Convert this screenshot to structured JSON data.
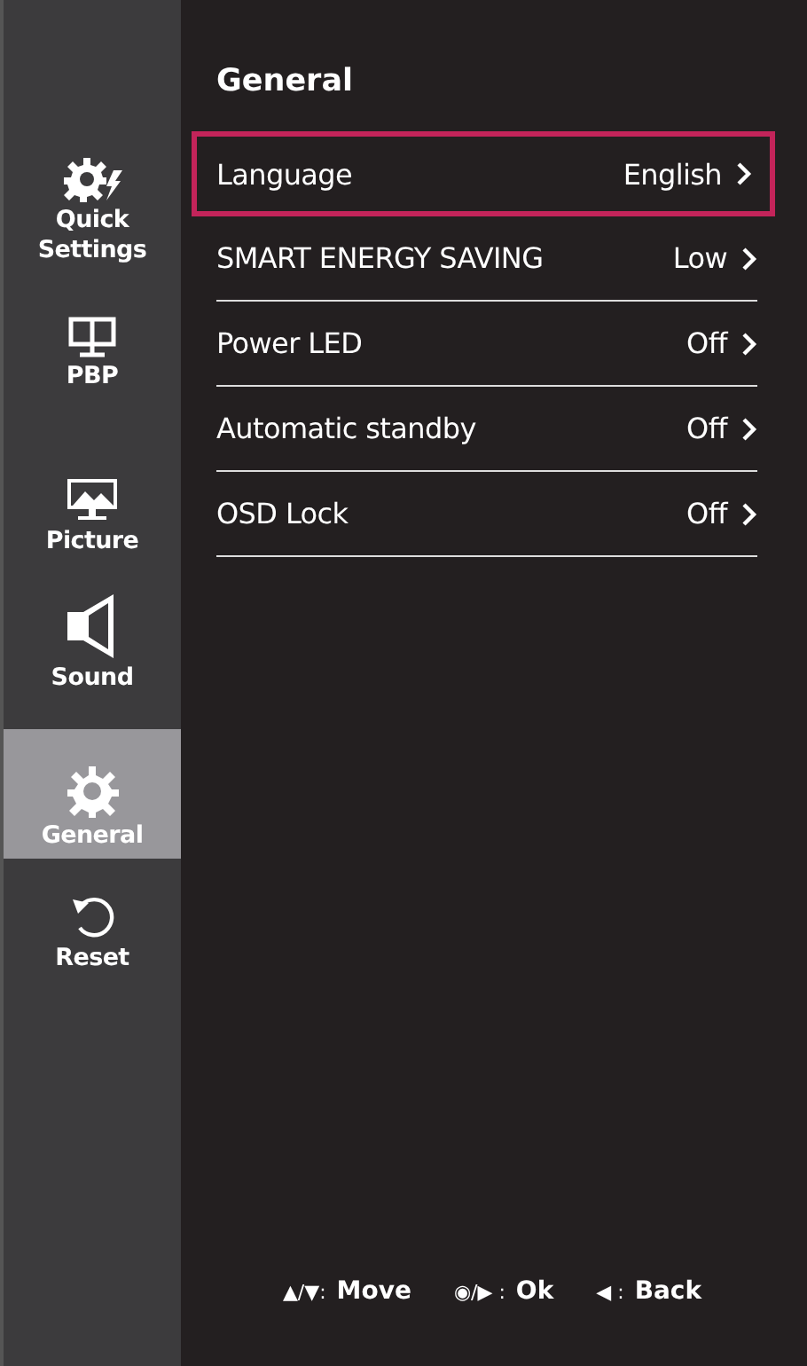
{
  "sidebar": {
    "items": [
      {
        "label": "Quick Settings",
        "selected": false
      },
      {
        "label": "PBP",
        "selected": false
      },
      {
        "label": "Picture",
        "selected": false
      },
      {
        "label": "Sound",
        "selected": false
      },
      {
        "label": "General",
        "selected": true
      },
      {
        "label": "Reset",
        "selected": false
      }
    ]
  },
  "panel": {
    "title": "General",
    "items": [
      {
        "label": "Language",
        "value": "English",
        "selected": true
      },
      {
        "label": "SMART ENERGY SAVING",
        "value": "Low",
        "selected": false
      },
      {
        "label": "Power LED",
        "value": "Off",
        "selected": false
      },
      {
        "label": "Automatic standby",
        "value": "Off",
        "selected": false
      },
      {
        "label": "OSD Lock",
        "value": "Off",
        "selected": false
      }
    ]
  },
  "footer": {
    "hints": [
      {
        "keys": "▲/▼:",
        "action": "Move"
      },
      {
        "keys": "◉/▶ :",
        "action": "Ok"
      },
      {
        "keys": "◀ :",
        "action": "Back"
      }
    ]
  }
}
